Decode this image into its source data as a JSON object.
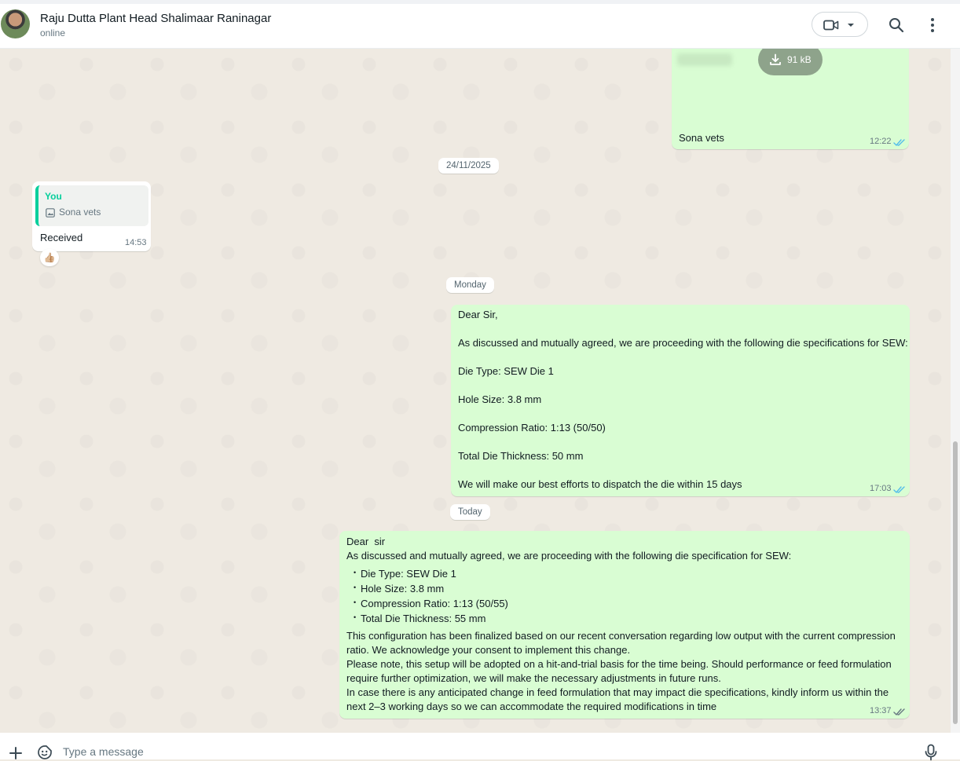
{
  "header": {
    "contact_name": "Raju Dutta Plant Head Shalimaar Raninagar",
    "status": "online"
  },
  "messages": {
    "file": {
      "size": "91 kB",
      "caption": "Sona vets",
      "time": "12:22"
    },
    "date1": "24/11/2025",
    "reply": {
      "quote_author": "You",
      "quote_text": "Sona vets",
      "text": "Received",
      "time": "14:53",
      "reaction": "👍🏼"
    },
    "date2": "Monday",
    "monday_msg": {
      "lines": [
        "Dear Sir,",
        "As discussed and mutually agreed, we are proceeding with the following die specifications for SEW:",
        "Die Type: SEW Die 1",
        "Hole Size: 3.8 mm",
        "Compression Ratio: 1:13 (50/50)",
        "Total Die Thickness: 50 mm",
        "We will make our best efforts to dispatch the die within 15 days"
      ],
      "time": "17:03"
    },
    "date3": "Today",
    "today_msg": {
      "greeting": "Dear  sir",
      "intro": "As discussed and mutually agreed, we are proceeding with the following die specification for SEW:",
      "bullets": [
        "Die Type: SEW Die 1",
        "Hole Size: 3.8 mm",
        "Compression Ratio: 1:13 (50/55)",
        "Total Die Thickness: 55 mm"
      ],
      "body": [
        "This configuration has been finalized based on our recent conversation regarding low output with the current compression",
        "ratio. We acknowledge your consent to implement this change.",
        "Please note, this setup will be adopted on a hit-and-trial basis for the time being. Should performance or feed formulation",
        "require further optimization, we will make the necessary adjustments in future runs.",
        "In case there is any anticipated change in feed formulation that may impact die specifications, kindly inform us within the",
        "next 2–3 working days so we can accommodate the required modifications in time"
      ],
      "time": "13:37"
    }
  },
  "composer": {
    "placeholder": "Type a message"
  },
  "colors": {
    "outgoing_bubble": "#d9fdd3",
    "incoming_bubble": "#ffffff",
    "chat_background": "#efeae2",
    "read_ticks": "#53bdeb",
    "accent": "#06cf9c"
  },
  "icons": [
    "video-call-icon",
    "chevron-down-icon",
    "search-icon",
    "more-options-icon",
    "download-icon",
    "image-icon",
    "double-check-icon",
    "plus-icon",
    "sticker-icon",
    "mic-icon"
  ]
}
